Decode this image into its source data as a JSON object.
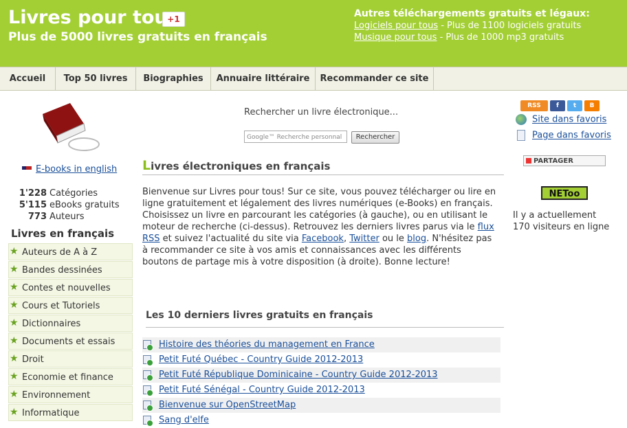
{
  "header": {
    "title": "Livres pour tous",
    "gplus": "+1",
    "subtitle": "Plus de 5000 livres gratuits en français",
    "other_title": "Autres téléchargements gratuits et légaux:",
    "links": [
      {
        "label": "Logiciels pour tous",
        "desc": " - Plus de 1100 logiciels gratuits"
      },
      {
        "label": "Musique pour tous",
        "desc": " - Plus de 1000 mp3 gratuits"
      }
    ]
  },
  "nav": [
    "Accueil",
    "Top 50 livres",
    "Biographies",
    "Annuaire littéraire",
    "Recommander ce site"
  ],
  "left": {
    "ebooks_english": "E-books in english",
    "stats": [
      {
        "num": "1'228",
        "label": "Catégories"
      },
      {
        "num": "5'115",
        "label": "eBooks gratuits"
      },
      {
        "num": "773",
        "label": "Auteurs"
      }
    ],
    "categories_heading": "Livres en français",
    "categories": [
      "Auteurs de A à Z",
      "Bandes dessinées",
      "Contes et nouvelles",
      "Cours et Tutoriels",
      "Dictionnaires",
      "Documents et essais",
      "Droit",
      "Economie et finance",
      "Environnement",
      "Informatique"
    ]
  },
  "search": {
    "label": "Rechercher un livre électronique...",
    "placeholder": "Google™ Recherche personnal",
    "button": "Rechercher"
  },
  "main": {
    "heading_first": "L",
    "heading_rest": "ivres électroniques en français",
    "intro": {
      "p1": "Bienvenue sur Livres pour tous! Sur ce site, vous pouvez télécharger ou lire en ligne gratuitement et légalement des livres numériques (e-Books) en français. Choisissez un livre en parcourant les catégories (à gauche), ou en utilisant le moteur de recherche (ci-dessus). Retrouvez les derniers livres parus via le ",
      "rss": "flux RSS",
      "p2": " et suivez l'actualité du site via ",
      "facebook": "Facebook",
      "sep": ", ",
      "twitter": "Twitter",
      "p3": " ou le ",
      "blog": "blog",
      "p4": ". N'hésitez pas à recommander ce site à vos amis et connaissances avec les différents boutons de partage mis à votre disposition (à droite). Bonne lecture!"
    },
    "latest_heading": "Les 10 derniers livres gratuits en français",
    "latest": [
      "Histoire des théories du management en France",
      "Petit Futé Québec - Country Guide 2012-2013",
      "Petit Futé République Dominicaine - Country Guide 2012-2013",
      "Petit Futé Sénégal - Country Guide 2012-2013",
      "Bienvenue sur OpenStreetMap",
      "Sang d'elfe"
    ]
  },
  "right": {
    "rss": "RSS",
    "fb": "f",
    "tw": "t",
    "bl": "B",
    "fav_site": "Site dans favoris",
    "fav_page": "Page dans favoris",
    "share": "PARTAGER",
    "netoo": "NEToo",
    "visitors": "Il y a actuellement 170 visiteurs en ligne"
  },
  "colors": {
    "header_green": "#a3cf35",
    "link_blue": "#1a4f9a"
  }
}
